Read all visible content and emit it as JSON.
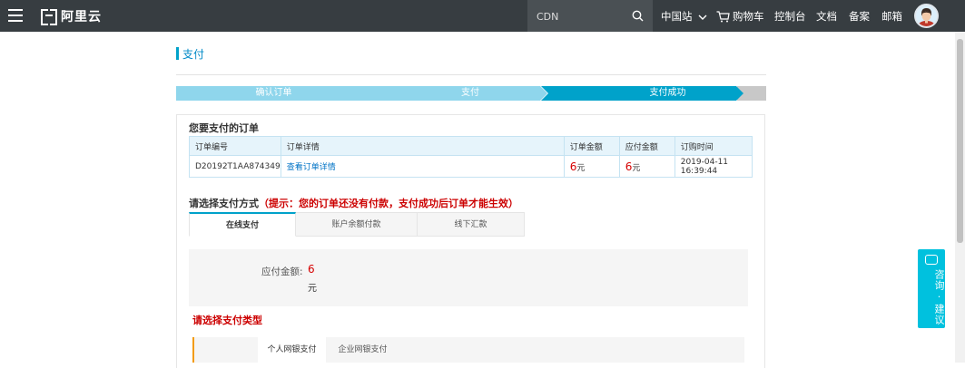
{
  "topbar": {
    "logo_text": "阿里云",
    "search_value": "CDN",
    "nav": {
      "region": "中国站",
      "cart": "购物车",
      "console": "控制台",
      "docs": "文档",
      "beian": "备案",
      "mail": "邮箱"
    }
  },
  "page": {
    "title": "支付",
    "steps": [
      "确认订单",
      "支付",
      "支付成功"
    ],
    "active_step": 1
  },
  "order": {
    "heading": "您要支付的订单",
    "columns": [
      "订单编号",
      "订单详情",
      "订单金额",
      "应付金额",
      "订购时间"
    ],
    "row": {
      "order_no": "D20192T1AA874349",
      "detail_link": "查看订单详情",
      "amount": "6",
      "amount_unit": "元",
      "payable": "6",
      "payable_unit": "元",
      "time": "2019-04-11 16:39:44"
    }
  },
  "payment": {
    "heading": "请选择支付方式",
    "notice": "（提示：您的订单还没有付款，支付成功后订单才能生效）",
    "tabs": [
      "在线支付",
      "账户余额付款",
      "线下汇款"
    ],
    "active_tab": 0,
    "amount_label": "应付金额:",
    "amount_value": "6",
    "amount_unit": "元",
    "type_heading": "请选择支付类型",
    "type_tabs": [
      "个人网银支付",
      "企业网银支付"
    ]
  },
  "consult": {
    "label": "咨询·建议"
  },
  "colors": {
    "topbar": "#373d41",
    "accent": "#00a2ca",
    "price": "#d60000",
    "step_done": "#8fd6ec",
    "step_active": "#00a2ca",
    "step_todo": "#c8c8c8",
    "consult": "#00c1de"
  }
}
